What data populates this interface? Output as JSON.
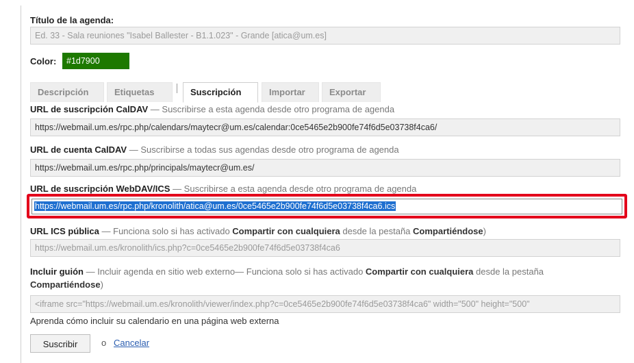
{
  "form": {
    "title_label": "Título de la agenda:",
    "title_value": "Ed. 33 - Sala reuniones \"Isabel Ballester - B1.1.023\" - Grande [atica@um.es]",
    "color_label": "Color:",
    "color_value": "#1d7900"
  },
  "tabs": [
    {
      "label": "Descripción",
      "active": false
    },
    {
      "label": "Etiquetas",
      "active": false
    },
    {
      "label": "Suscripción",
      "active": true
    },
    {
      "label": "Importar",
      "active": false
    },
    {
      "label": "Exportar",
      "active": false
    }
  ],
  "subscription": {
    "caldav_sub_label": "URL de suscripción CalDAV",
    "caldav_sub_hint": "— Suscribirse a esta agenda desde otro programa de agenda",
    "caldav_sub_url": "https://webmail.um.es/rpc.php/calendars/maytecr@um.es/calendar:0ce5465e2b900fe74f6d5e03738f4ca6/",
    "caldav_acct_label": "URL de cuenta CalDAV",
    "caldav_acct_hint": "— Suscribirse a todas sus agendas desde otro programa de agenda",
    "caldav_acct_url": "https://webmail.um.es/rpc.php/principals/maytecr@um.es/",
    "webdav_label": "URL de suscripción WebDAV/ICS",
    "webdav_hint": "— Suscribirse a esta agenda desde otro programa de agenda",
    "webdav_url": "https://webmail.um.es/rpc.php/kronolith/atica@um.es/0ce5465e2b900fe74f6d5e03738f4ca6.ics",
    "ics_label": "URL ICS pública",
    "ics_hint_1": "— Funciona solo si has activado ",
    "ics_hint_bold_1": "Compartir con cualquiera",
    "ics_hint_2": " desde la pestaña ",
    "ics_hint_bold_2": "Compartiéndose",
    "ics_hint_3": ")",
    "ics_url": "https://webmail.um.es/kronolith/ics.php?c=0ce5465e2b900fe74f6d5e03738f4ca6",
    "embed_label": "Incluir guión",
    "embed_hint_1": "— Incluir agenda en sitio web externo— Funciona solo si has activado ",
    "embed_hint_bold_1": "Compartir con cualquiera",
    "embed_hint_2": " desde la pestaña",
    "embed_hint_bold_2": "Compartiéndose",
    "embed_hint_3": ")",
    "embed_code": "<iframe src=\"https://webmail.um.es/kronolith/viewer/index.php?c=0ce5465e2b900fe74f6d5e03738f4ca6\" width=\"500\" height=\"500\"",
    "embed_help": "Aprenda cómo incluir su calendario en una página web externa"
  },
  "actions": {
    "submit_label": "Suscribir",
    "or_label": "o",
    "cancel_label": "Cancelar"
  },
  "colors": {
    "highlight_border": "#e3001b",
    "selection": "#1e6fd0",
    "swatch": "#1d7900"
  }
}
